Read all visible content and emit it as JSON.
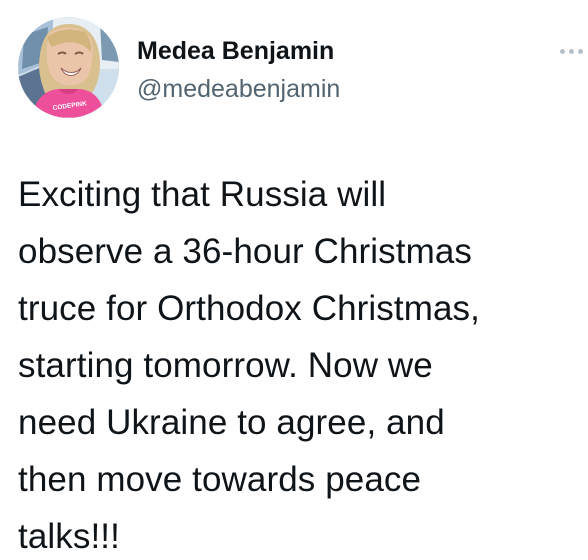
{
  "author": {
    "display_name": "Medea Benjamin",
    "handle": "@medeabenjamin",
    "avatar_shirt_text": "CODEPINK"
  },
  "tweet": {
    "text": "Exciting that Russia will\nobserve a 36-hour Christmas\ntruce for Orthodox Christmas,\nstarting tomorrow. Now we\nneed Ukraine to agree, and\nthen move towards peace\ntalks!!!"
  },
  "actions": {
    "more_icon": "more-horizontal-icon"
  },
  "colors": {
    "text": "#0f1419",
    "handle": "#536471",
    "more_icon": "#b7c0c8",
    "background": "#ffffff"
  }
}
